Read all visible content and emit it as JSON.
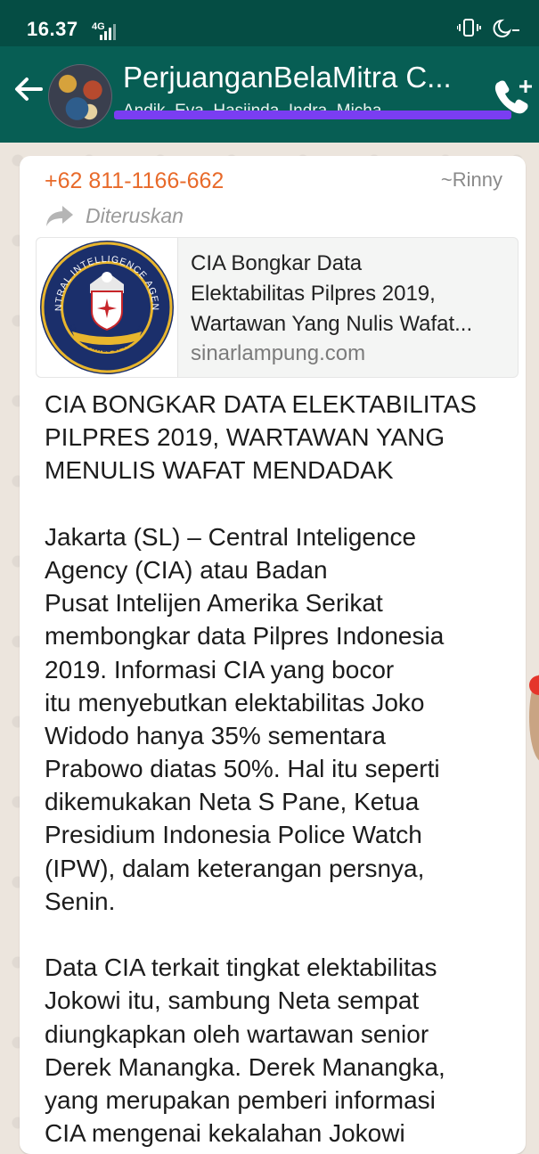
{
  "status_bar": {
    "time": "16.37",
    "network": "4G",
    "icons": [
      "signal-icon",
      "vibrate-icon",
      "do-not-disturb-icon"
    ]
  },
  "header": {
    "title": "PerjuanganBelaMitra C...",
    "members": "Andik, Eva, Hasiinda, Indra, Micha...",
    "back_icon": "arrow-left-icon",
    "call_icon": "add-call-icon",
    "colors": {
      "bar": "#075e54",
      "status": "#054d44",
      "redaction": "#7a3df2"
    }
  },
  "message": {
    "sender_phone": "+62 811-1166-662",
    "sender_name": "~Rinny",
    "forwarded_label": "Diteruskan",
    "link_preview": {
      "thumbnail": "cia-seal-logo",
      "seal_text": "CENTRAL INTELLIGENCE AGENCY",
      "seal_bottom": "UNITED STATES OF AMERICA",
      "title_lines": [
        "CIA Bongkar Data",
        "Elektabilitas Pilpres 2019,",
        "Wartawan Yang Nulis Wafat..."
      ],
      "domain": "sinarlampung.com"
    },
    "paragraphs": [
      [
        "CIA BONGKAR DATA ELEKTABILITAS",
        "PILPRES 2019, WARTAWAN YANG",
        "MENULIS WAFAT MENDADAK"
      ],
      [
        "Jakarta (SL) – Central Inteligence",
        "Agency (CIA) atau Badan",
        "Pusat Intelijen Amerika Serikat",
        "membongkar data Pilpres Indonesia",
        "2019. Informasi CIA yang bocor",
        "itu menyebutkan elektabilitas Joko",
        "Widodo hanya 35% sementara",
        "Prabowo diatas 50%. Hal itu seperti",
        "dikemukakan Neta S Pane, Ketua",
        "Presidium Indonesia Police Watch",
        "(IPW), dalam keterangan persnya,",
        "Senin."
      ],
      [
        "Data CIA terkait tingkat elektabilitas",
        "Jokowi itu, sambung Neta sempat",
        "diungkapkan oleh wartawan senior",
        "Derek Manangka. Derek Manangka,",
        "yang merupakan pemberi informasi",
        "CIA mengenai kekalahan Jokowi"
      ]
    ],
    "colors": {
      "phone": "#e86a2a",
      "bubble": "#ffffff",
      "wallpaper": "#ece5dd"
    }
  }
}
